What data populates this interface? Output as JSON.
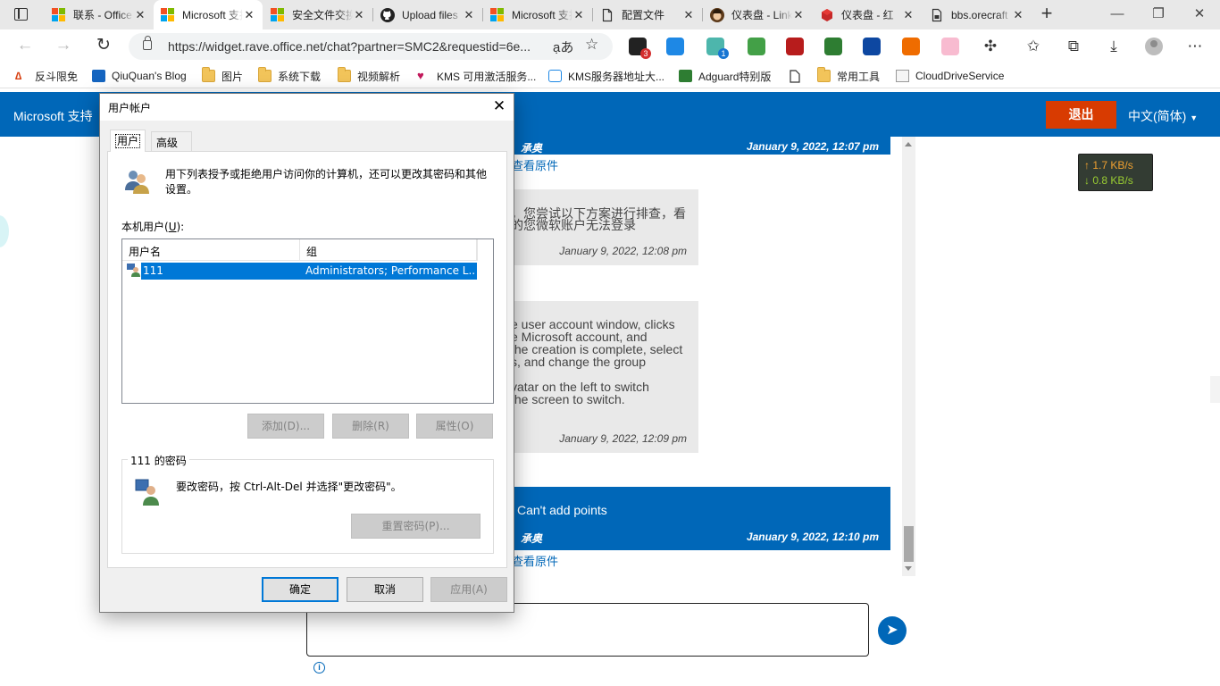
{
  "browser": {
    "tabs": [
      {
        "label": "联系 - Office",
        "active": false
      },
      {
        "label": "Microsoft 支持",
        "active": true
      },
      {
        "label": "安全文件交换",
        "active": false
      },
      {
        "label": "Upload files",
        "active": false
      },
      {
        "label": "Microsoft 支持",
        "active": false
      },
      {
        "label": "配置文件",
        "active": false
      },
      {
        "label": "仪表盘 - LinkAI",
        "active": false
      },
      {
        "label": "仪表盘 - 红",
        "active": false
      },
      {
        "label": "bbs.orecraft",
        "active": false
      }
    ],
    "address": {
      "url": "https://widget.rave.office.net/chat?partner=SMC2&requestid=6e..."
    },
    "extensions": [
      {
        "name": "ext-1-icon",
        "color": "#222222",
        "badge": "3",
        "badge_color": "#d32f2f"
      },
      {
        "name": "ext-2-icon",
        "color": "#1e88e5",
        "badge": "",
        "badge_color": ""
      },
      {
        "name": "ext-3-icon",
        "color": "#4db6ac",
        "badge": "1",
        "badge_color": "#1976d2"
      },
      {
        "name": "ext-4-icon",
        "color": "#43a047",
        "badge": "",
        "badge_color": ""
      },
      {
        "name": "ext-5-icon",
        "color": "#b71c1c",
        "badge": "",
        "badge_color": ""
      },
      {
        "name": "ext-6-icon",
        "color": "#2e7d32",
        "badge": "",
        "badge_color": ""
      },
      {
        "name": "ext-7-icon",
        "color": "#0d47a1",
        "badge": "",
        "badge_color": ""
      },
      {
        "name": "ext-8-icon",
        "color": "#ef6c00",
        "badge": "",
        "badge_color": ""
      },
      {
        "name": "ext-9-icon",
        "color": "#f8bbd0",
        "badge": "",
        "badge_color": ""
      }
    ],
    "bookmarks": [
      {
        "label": "反斗限免",
        "type": "site"
      },
      {
        "label": "QiuQuan's Blog",
        "type": "site"
      },
      {
        "label": "图片",
        "type": "folder"
      },
      {
        "label": "系统下载",
        "type": "folder"
      },
      {
        "label": "视频解析",
        "type": "folder"
      },
      {
        "label": "KMS 可用激活服务...",
        "type": "site"
      },
      {
        "label": "KMS服务器地址大...",
        "type": "site"
      },
      {
        "label": "Adguard特别版",
        "type": "site"
      },
      {
        "label": "",
        "type": "page"
      },
      {
        "label": "常用工具",
        "type": "folder"
      },
      {
        "label": "CloudDriveService",
        "type": "site"
      }
    ]
  },
  "site": {
    "brand": "Microsoft 支持",
    "logout": "退出",
    "language": "中文(简体)"
  },
  "chat": {
    "messages": [
      {
        "sender": "承奥",
        "time": "January 9, 2022, 12:07 pm",
        "link": "查看原件"
      },
      {
        "line1": "，您尝试以下方案进行排查，看",
        "line2": "的您微软账户无法登录",
        "time": "January 9, 2022, 12:08 pm"
      },
      {
        "lines": [
          "e user account window, clicks",
          "e Microsoft account, and",
          "the creation is complete, select",
          "s, and change the group",
          "",
          "vatar on the left to switch",
          "the screen to switch."
        ],
        "time": "January 9, 2022, 12:09 pm"
      },
      {
        "text": "Can't add points",
        "sender": "承奥",
        "time": "January 9, 2022, 12:10 pm",
        "link": "查看原件"
      }
    ]
  },
  "net_speed": {
    "up": "↑ 1.7 KB/s",
    "down": "↓ 0.8 KB/s"
  },
  "dialog": {
    "title": "用户帐户",
    "tabs": [
      "用户",
      "高级"
    ],
    "intro": "用下列表授予或拒绝用户访问你的计算机，还可以更改其密码和其他设置。",
    "list_label": "本机用户(",
    "list_label_key": "U",
    "list_label_end": "):",
    "columns": [
      "用户名",
      "组"
    ],
    "users": [
      {
        "name": "111",
        "group": "Administrators; Performance L..."
      }
    ],
    "buttons": {
      "add": "添加(D)...",
      "remove": "删除(R)",
      "properties": "属性(O)",
      "reset_password": "重置密码(P)...",
      "ok": "确定",
      "cancel": "取消",
      "apply": "应用(A)"
    },
    "password_group": "111 的密码",
    "password_text": "要改密码，按 Ctrl-Alt-Del 并选择\"更改密码\"。"
  },
  "colors": {
    "brand_blue": "#0067b8",
    "logout_red": "#d83b01",
    "selection_blue": "#0078d7"
  }
}
